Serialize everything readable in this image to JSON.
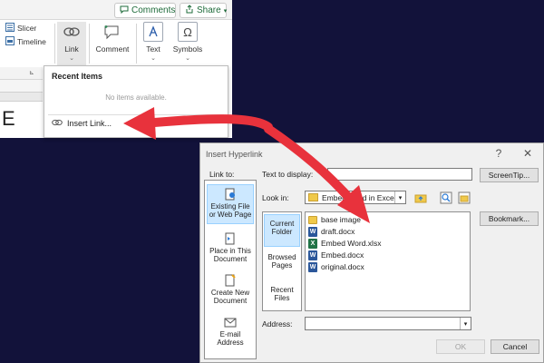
{
  "ribbon": {
    "comments_label": "Comments",
    "share_label": "Share",
    "slicer_label": "Slicer",
    "timeline_label": "Timeline",
    "link_label": "Link",
    "comment_label": "Comment",
    "text_label": "Text",
    "symbols_label": "Symbols",
    "cell_text": "E"
  },
  "dropdown": {
    "header": "Recent Items",
    "empty_text": "No items available.",
    "insert_link_label": "Insert Link..."
  },
  "dialog": {
    "title": "Insert Hyperlink",
    "help": "?",
    "close": "✕",
    "link_to_label": "Link to:",
    "text_to_display_label": "Text to display:",
    "look_in_label": "Look in:",
    "look_in_value": "Embed Word in Excel",
    "screentip_label": "ScreenTip...",
    "bookmark_label": "Bookmark...",
    "address_label": "Address:",
    "ok_label": "OK",
    "cancel_label": "Cancel",
    "link_to_items": [
      {
        "label": "Existing File or Web Page"
      },
      {
        "label": "Place in This Document"
      },
      {
        "label": "Create New Document"
      },
      {
        "label": "E-mail Address"
      }
    ],
    "inner_nav": [
      {
        "label": "Current Folder"
      },
      {
        "label": "Browsed Pages"
      },
      {
        "label": "Recent Files"
      }
    ],
    "files": [
      {
        "name": "base image",
        "type": "folder"
      },
      {
        "name": "draft.docx",
        "type": "word"
      },
      {
        "name": "Embed Word.xlsx",
        "type": "excel"
      },
      {
        "name": "Embed.docx",
        "type": "word"
      },
      {
        "name": "original.docx",
        "type": "word"
      }
    ]
  },
  "colors": {
    "background": "#12123a",
    "arrow": "#e8323c",
    "accent": "#1e6b3a",
    "selection": "#cce8ff"
  }
}
